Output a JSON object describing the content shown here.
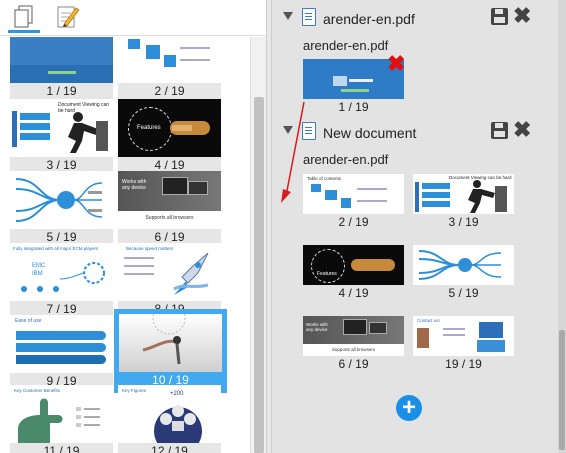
{
  "left_panel": {
    "tabs": [
      {
        "icon": "pages-icon",
        "active": true
      },
      {
        "icon": "annotate-icon",
        "active": false
      }
    ],
    "thumbnails": [
      {
        "label": "1 / 19",
        "selected": false
      },
      {
        "label": "2 / 19",
        "selected": false
      },
      {
        "label": "3 / 19",
        "selected": false,
        "title": "Document Viewing can be hard"
      },
      {
        "label": "4 / 19",
        "selected": false,
        "title": "Features"
      },
      {
        "label": "5 / 19",
        "selected": false
      },
      {
        "label": "6 / 19",
        "selected": false,
        "title": "Works with any device",
        "subtitle": "Supports all browsers"
      },
      {
        "label": "7 / 19",
        "selected": false,
        "title": "Fully integrated with all major ECM players"
      },
      {
        "label": "8 / 19",
        "selected": false,
        "title": "Because speed matters"
      },
      {
        "label": "9 / 19",
        "selected": false,
        "title": "Ease of use"
      },
      {
        "label": "10 / 19",
        "selected": true
      },
      {
        "label": "11 / 19",
        "selected": false,
        "title": "Key Customer Benefits"
      },
      {
        "label": "12 / 19",
        "selected": false,
        "title": "Key Figures"
      }
    ]
  },
  "right_panel": {
    "documents": [
      {
        "title": "arender-en.pdf",
        "source_file": "arender-en.pdf",
        "pages": [
          {
            "label": "1 / 19"
          }
        ]
      },
      {
        "title": "New document",
        "source_file": "arender-en.pdf",
        "pages": [
          {
            "label": "2 / 19",
            "title": "Table of contents"
          },
          {
            "label": "3 / 19",
            "title": "Document Viewing can be hard"
          },
          {
            "label": "4 / 19",
            "title": "Features"
          },
          {
            "label": "5 / 19"
          },
          {
            "label": "6 / 19",
            "title": "Works with any device",
            "subtitle": "Supports all browsers"
          },
          {
            "label": "19 / 19",
            "title": "Contact us!"
          }
        ]
      }
    ],
    "add_button": "+"
  },
  "colors": {
    "selected": "#40a9f0",
    "accent": "#2a96e8",
    "delete": "#e01010",
    "panel_bg": "#e3e3e3"
  }
}
